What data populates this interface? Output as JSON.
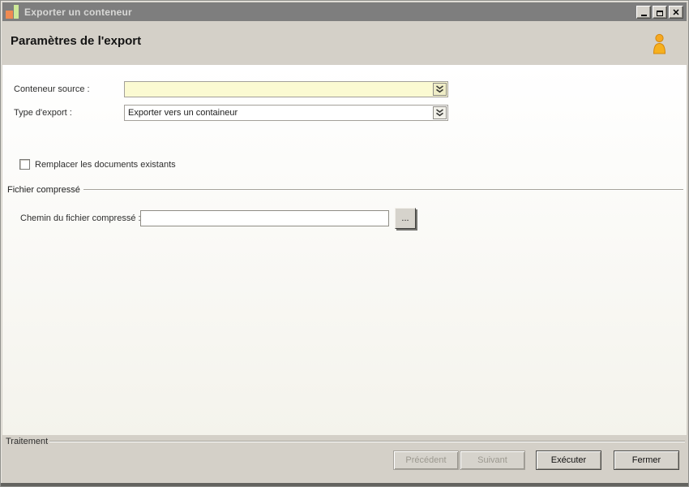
{
  "window": {
    "title": "Exporter un conteneur",
    "icons": {
      "app": "bar-chart-icon",
      "minimize": "minimize-icon",
      "maximize": "maximize-icon",
      "close": "close-icon"
    }
  },
  "header": {
    "title": "Paramètres de l'export",
    "icon": "user-icon"
  },
  "form": {
    "container_source": {
      "label": "Conteneur source :",
      "value": "",
      "icon": "double-chevron-down-icon"
    },
    "export_type": {
      "label": "Type d'export :",
      "value": "Exporter vers un containeur",
      "icon": "double-chevron-down-icon"
    },
    "replace_docs": {
      "label": "Remplacer les documents existants",
      "checked": false
    },
    "compressed_group": {
      "title": "Fichier compressé"
    },
    "compressed_path": {
      "label": "Chemin du fichier compressé :",
      "value": "",
      "browse_label": "..."
    }
  },
  "footer": {
    "group_label": "Traitement",
    "buttons": [
      {
        "label": "Précédent",
        "enabled": false
      },
      {
        "label": "Suivant",
        "enabled": false
      },
      {
        "label": "Exécuter",
        "enabled": true
      },
      {
        "label": "Fermer",
        "enabled": true
      }
    ]
  },
  "colors": {
    "titlebar_bg": "#7E7E7E",
    "titlebar_text": "#D8D8D6",
    "chrome_bg": "#D4D0C8",
    "content_bg_top": "#FFFFFF",
    "content_bg_bottom": "#F4F3EC",
    "source_field_bg": "#FBFAD2",
    "app_icon_orange": "#EF8A51",
    "app_icon_green": "#CDE998",
    "user_icon_orange": "#F6A821",
    "border_dark_bottom": "#63635F"
  }
}
